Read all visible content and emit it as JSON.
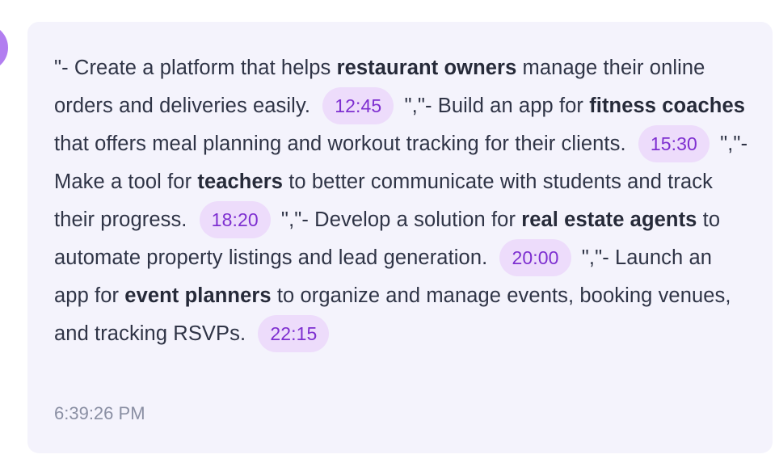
{
  "message": {
    "segments": [
      {
        "type": "text",
        "text": "\"- Create a platform that helps "
      },
      {
        "type": "bold",
        "text": "restaurant owners"
      },
      {
        "type": "text",
        "text": " manage their online orders and deliveries easily. "
      },
      {
        "type": "chip",
        "text": "12:45"
      },
      {
        "type": "text",
        "text": " \",\"- Build an app for "
      },
      {
        "type": "bold",
        "text": "fitness coaches"
      },
      {
        "type": "text",
        "text": " that offers meal planning and workout tracking for their clients. "
      },
      {
        "type": "chip",
        "text": "15:30"
      },
      {
        "type": "text",
        "text": " \",\"- Make a tool for "
      },
      {
        "type": "bold",
        "text": "teachers"
      },
      {
        "type": "text",
        "text": " to better communicate with students and track their progress. "
      },
      {
        "type": "chip",
        "text": "18:20"
      },
      {
        "type": "text",
        "text": " \",\"- Develop a solution for "
      },
      {
        "type": "bold",
        "text": "real estate agents"
      },
      {
        "type": "text",
        "text": " to automate property listings and lead generation. "
      },
      {
        "type": "chip",
        "text": "20:00"
      },
      {
        "type": "text",
        "text": " \",\"- Launch an app for "
      },
      {
        "type": "bold",
        "text": "event planners"
      },
      {
        "type": "text",
        "text": " to organize and manage events, booking venues, and tracking RSVPs. "
      },
      {
        "type": "chip",
        "text": "22:15"
      }
    ],
    "timestamp": "6:39:26 PM"
  },
  "colors": {
    "bubble_background": "#f4f3fc",
    "chip_background": "#eddcfb",
    "chip_text": "#7e2fd0",
    "avatar": "#b27ef0"
  }
}
